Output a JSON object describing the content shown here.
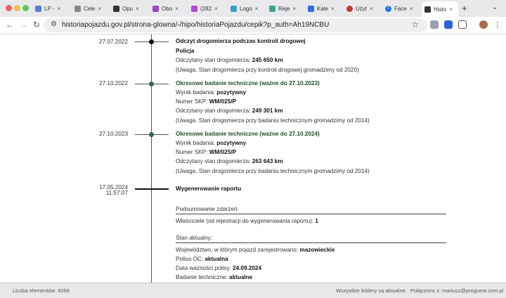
{
  "tabs": [
    {
      "label": "LP -",
      "color": "#5a7bd4"
    },
    {
      "label": "Cele",
      "color": "#888888"
    },
    {
      "label": "Opu",
      "color": "#333333"
    },
    {
      "label": "Obo",
      "color": "#9b45c9"
    },
    {
      "label": "(282",
      "color": "#b04cd0"
    },
    {
      "label": "Logo",
      "color": "#3aa0c8"
    },
    {
      "label": "Reje",
      "color": "#3aa890"
    },
    {
      "label": "Kale",
      "color": "#2f6fd6"
    },
    {
      "label": "Użyt",
      "color": "#c0392b"
    },
    {
      "label": "Face",
      "color": "#1877f2"
    },
    {
      "label": "Histo",
      "color": "#333333"
    }
  ],
  "toolbar": {
    "url": "historiapojazdu.gov.pl/strona-glowna/-/hipo/historiaPojazdu/cepik?p_auth=Ah19NCBU"
  },
  "events": [
    {
      "date": "27.07.2022",
      "title": "Odczyt drogomierza podczas kontroli drogowej",
      "subtitle": "Policja",
      "reading_label": "Odczytany stan drogomierza:",
      "reading_value": "245 650 km",
      "note": "(Uwaga. Stan drogomierza przy kontroli drogowej gromadzimy od 2020)"
    },
    {
      "date": "27.10.2022",
      "title": "Okresowe badanie techniczne (ważne do 27.10.2023)",
      "result_label": "Wynik badania:",
      "result_value": "pozytywny",
      "skp_label": "Numer SKP:",
      "skp_value": "WM/025/P",
      "reading_label": "Odczytany stan drogomierza:",
      "reading_value": "249 301 km",
      "note": "(Uwaga. Stan drogomierza przy badaniu technicznym gromadzimy od 2014)"
    },
    {
      "date": "27.10.2023",
      "title": "Okresowe badanie techniczne (ważne do 27.10.2024)",
      "result_label": "Wynik badania:",
      "result_value": "pozytywny",
      "skp_label": "Numer SKP:",
      "skp_value": "WM/025/P",
      "reading_label": "Odczytany stan drogomierza:",
      "reading_value": "263 643 km",
      "note": "(Uwaga. Stan drogomierza przy badaniu technicznym gromadzimy od 2014)"
    }
  ],
  "report": {
    "date": "17.05.2024",
    "time": "11:57:07",
    "title": "Wygenerowanie raportu"
  },
  "summary": {
    "heading": "Podsumowanie zdarzeń:",
    "owners_label": "Właściciele (od rejestracji do wygenerowania raportu):",
    "owners_value": "1"
  },
  "current": {
    "heading": "Stan aktualny:",
    "voivodeship_label": "Województwo, w którym pojazd zarejestrowano:",
    "voivodeship_value": "mazowieckie",
    "oc_label": "Polisa OC:",
    "oc_value": "aktualna",
    "policy_label": "Data ważności polisy:",
    "policy_value": "24.09.2024",
    "inspection_label": "Badanie techniczne:",
    "inspection_value": "aktualne"
  },
  "bottom_bar": {
    "count_label": "Liczba elementów: 6068",
    "right_status": "Wszystkie foldery są aktualne.",
    "connection": "Połączono z: mariusz@proguest.com.pl"
  },
  "colors": {
    "green_dot": "#2e6b44",
    "black_dot": "#111111"
  }
}
